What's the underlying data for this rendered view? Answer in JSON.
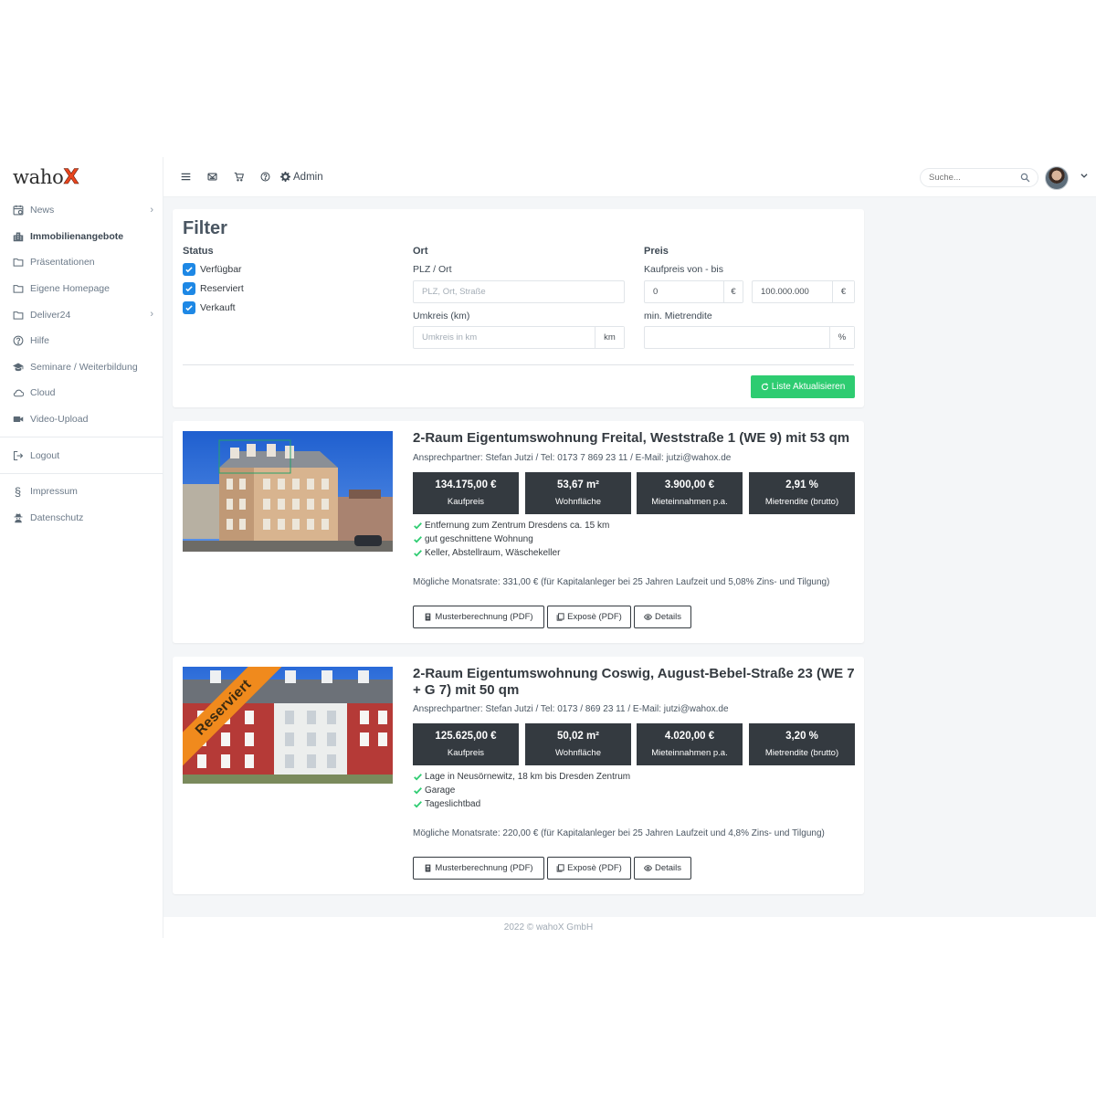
{
  "app": {
    "logo_text": "waho",
    "logo_x": "X"
  },
  "sidebar": {
    "items": [
      {
        "label": "News",
        "icon": "calendar-icon",
        "has_chevron": true
      },
      {
        "label": "Immobilienangebote",
        "icon": "building-icon",
        "active": true
      },
      {
        "label": "Präsentationen",
        "icon": "folder-icon"
      },
      {
        "label": "Eigene Homepage",
        "icon": "folder-icon"
      },
      {
        "label": "Deliver24",
        "icon": "folder-icon",
        "has_chevron": true
      },
      {
        "label": "Hilfe",
        "icon": "question-circle-icon"
      },
      {
        "label": "Seminare / Weiterbildung",
        "icon": "graduation-cap-icon"
      },
      {
        "label": "Cloud",
        "icon": "cloud-icon"
      },
      {
        "label": "Video-Upload",
        "icon": "video-icon"
      },
      {
        "label": "Logout",
        "icon": "sign-out-icon"
      },
      {
        "label": "Impressum",
        "icon": "paragraph-icon"
      },
      {
        "label": "Datenschutz",
        "icon": "user-secret-icon"
      }
    ]
  },
  "topbar": {
    "icons": [
      "menu-icon",
      "mail-icon",
      "cart-icon",
      "help-icon"
    ],
    "admin_label": "Admin",
    "search_placeholder": "Suche..."
  },
  "filter": {
    "title": "Filter",
    "status_label": "Status",
    "status_options": [
      "Verfügbar",
      "Reserviert",
      "Verkauft"
    ],
    "ort_label": "Ort",
    "plz_label": "PLZ / Ort",
    "plz_placeholder": "PLZ, Ort, Straße",
    "umkreis_label": "Umkreis (km)",
    "umkreis_placeholder": "Umkreis in km",
    "umkreis_unit": "km",
    "preis_label": "Preis",
    "kaufpreis_label": "Kaufpreis von - bis",
    "price_from": "0",
    "price_to": "100.000.000",
    "currency": "€",
    "mietrendite_label": "min. Mietrendite",
    "percent": "%",
    "update_button": "Liste Aktualisieren"
  },
  "listings": [
    {
      "title": "2-Raum Eigentumswohnung Freital, Weststraße 1 (WE 9) mit 53 qm",
      "contact": "Ansprechpartner: Stefan Jutzi / Tel: 0173 7 869 23 11 / E-Mail: jutzi@wahox.de",
      "stats": [
        {
          "value": "134.175,00 €",
          "label": "Kaufpreis"
        },
        {
          "value": "53,67 m²",
          "label": "Wohnfläche"
        },
        {
          "value": "3.900,00 €",
          "label": "Mieteinnahmen p.a."
        },
        {
          "value": "2,91 %",
          "label": "Mietrendite (brutto)"
        }
      ],
      "features": [
        "Entfernung zum Zentrum Dresdens ca. 15 km",
        "gut geschnittene Wohnung",
        "Keller, Abstellraum, Wäschekeller"
      ],
      "rate": "Mögliche Monatsrate: 331,00 € (für Kapitalanleger bei 25 Jahren Laufzeit und 5,08% Zins- und Tilgung)",
      "buttons": [
        "Musterberechnung (PDF)",
        "Exposè (PDF)",
        "Details"
      ]
    },
    {
      "title": "2-Raum Eigentumswohnung Coswig, August-Bebel-Straße 23 (WE 7 + G 7) mit 50 qm",
      "ribbon": "Reserviert",
      "contact": "Ansprechpartner: Stefan Jutzi / Tel: 0173 / 869 23 11 / E-Mail: jutzi@wahox.de",
      "stats": [
        {
          "value": "125.625,00 €",
          "label": "Kaufpreis"
        },
        {
          "value": "50,02 m²",
          "label": "Wohnfläche"
        },
        {
          "value": "4.020,00 €",
          "label": "Mieteinnahmen p.a."
        },
        {
          "value": "3,20 %",
          "label": "Mietrendite (brutto)"
        }
      ],
      "features": [
        "Lage in Neusörnewitz, 18 km bis Dresden Zentrum",
        "Garage",
        "Tageslichtbad"
      ],
      "rate": "Mögliche Monatsrate: 220,00 € (für Kapitalanleger bei 25 Jahren Laufzeit und 4,8% Zins- und Tilgung)",
      "buttons": [
        "Musterberechnung (PDF)",
        "Exposè (PDF)",
        "Details"
      ]
    }
  ],
  "footer": {
    "text": "2022 © wahoX GmbH"
  },
  "colors": {
    "accent_green": "#2ecc71",
    "checkbox_blue": "#1e88e5",
    "stat_dark": "#343a40",
    "ribbon_orange": "#f08a1d",
    "logo_red": "#e8451e"
  }
}
